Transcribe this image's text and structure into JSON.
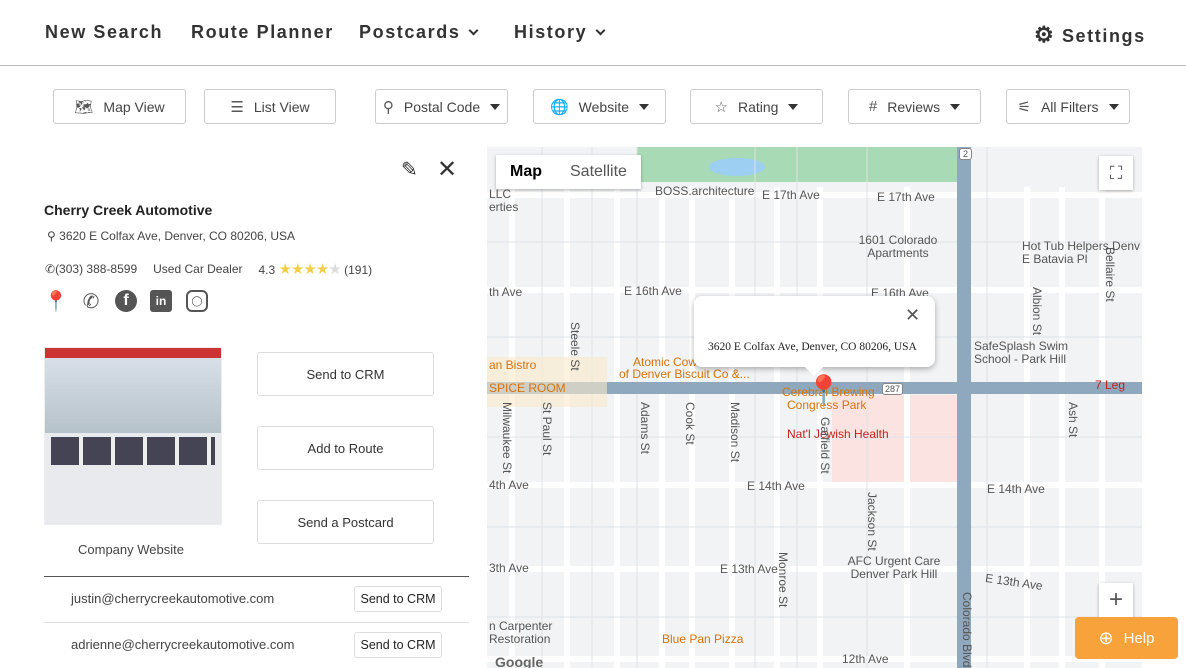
{
  "nav": {
    "new_search": "New Search",
    "route_planner": "Route Planner",
    "postcards": "Postcards",
    "history": "History",
    "settings": "Settings"
  },
  "filters": {
    "map_view": "Map View",
    "list_view": "List View",
    "postal_code": "Postal Code",
    "website": "Website",
    "rating": "Rating",
    "reviews": "Reviews",
    "all_filters": "All Filters"
  },
  "business": {
    "name": "Cherry Creek Automotive",
    "address": "3620 E Colfax Ave, Denver, CO 80206, USA",
    "phone": "(303) 388-8599",
    "category": "Used Car Dealer",
    "rating": "4.3",
    "rating_value": 4.3,
    "review_count": "(191)",
    "website_label": "Company Website"
  },
  "actions": {
    "send_crm": "Send to CRM",
    "add_route": "Add to Route",
    "send_postcard": "Send a Postcard"
  },
  "emails": [
    {
      "email": "justin@cherrycreekautomotive.com",
      "button": "Send to CRM"
    },
    {
      "email": "adrienne@cherrycreekautomotive.com",
      "button": "Send to CRM"
    }
  ],
  "map": {
    "tab_map": "Map",
    "tab_satellite": "Satellite",
    "popup_address": "3620 E Colfax Ave, Denver, CO 80206, USA",
    "labels": [
      "BOSS.architecture",
      "E 17th Ave",
      "E 17th Ave",
      "1601 Colorado Apartments",
      "Hot Tub Helpers Denv",
      "E Batavia Pl",
      "E 16th Ave",
      "E 16th Ave",
      "SafeSplash Swim School - Park Hill",
      "Atomic Cow",
      "of Denver Biscuit Co &...",
      "Cerebral Brewing",
      "Congress Park",
      "Nat'l Jewish Health",
      "E 14th Ave",
      "E 14th Ave",
      "AFC Urgent Care Denver Park Hill",
      "E 13th Ave",
      "E 13th Ave",
      "Blue Pan Pizza",
      "an Bistro",
      "SPICE ROOM",
      "7 Leg",
      "Steele St",
      "St Paul St",
      "Adams St",
      "Cook St",
      "Madison St",
      "Garfield St",
      "Jackson St",
      "Albion St",
      "Ash St",
      "Bellaire St",
      "Milwaukee St",
      "Monroe St",
      "Colorado Blvd",
      "4th Ave",
      "3th Ave",
      "th Ave",
      "12th Ave",
      "n Carpenter Restoration",
      "Google",
      "287",
      "2",
      "LLC",
      "erties"
    ]
  },
  "help": "Help"
}
